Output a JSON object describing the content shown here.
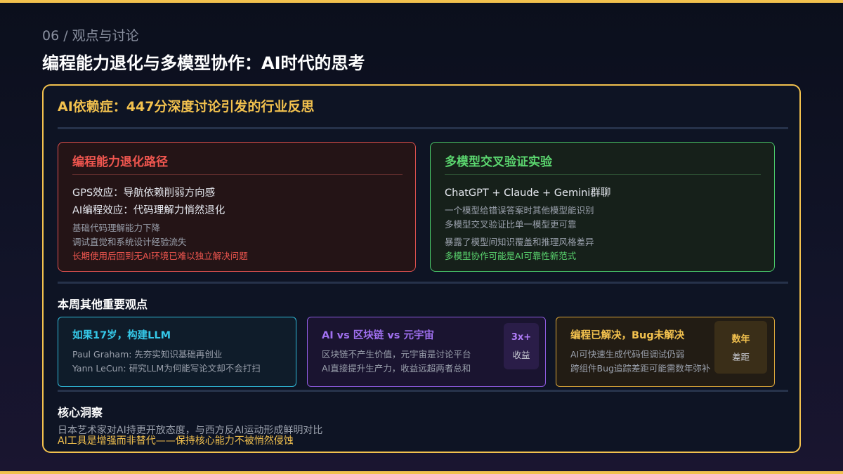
{
  "header": {
    "section_label": "06 / 观点与讨论",
    "title": "编程能力退化与多模型协作：AI时代的思考"
  },
  "panel": {
    "title": "AI依赖症：447分深度讨论引发的行业反思",
    "degradation": {
      "title": "编程能力退化路径",
      "main_lines": [
        "GPS效应：导航依赖削弱方向感",
        "AI编程效应：代码理解力悄然退化"
      ],
      "sub_lines": [
        "基础代码理解能力下降",
        "调试直觉和系统设计经验流失"
      ],
      "highlight": "长期使用后回到无AI环境已难以独立解决问题"
    },
    "multimodel": {
      "title": "多模型交叉验证实验",
      "main_line": "ChatGPT + Claude + Gemini群聊",
      "sub_lines": [
        "一个模型给错误答案时其他模型能识别",
        "多模型交叉验证比单一模型更可靠",
        "暴露了模型间知识覆盖和推理风格差异"
      ],
      "highlight": "多模型协作可能是AI可靠性新范式"
    },
    "weekly": {
      "heading": "本周其他重要观点",
      "cards": [
        {
          "title": "如果17岁，构建LLM",
          "lines": [
            "Paul Graham: 先夯实知识基础再创业",
            "Yann LeCun: 研究LLM为何能写论文却不会打扫"
          ]
        },
        {
          "title": "AI vs 区块链 vs 元宇宙",
          "lines": [
            "区块链不产生价值，元宇宙是讨论平台",
            "AI直接提升生产力，收益远超两者总和"
          ],
          "badge": {
            "value": "3x+",
            "label": "收益"
          }
        },
        {
          "title": "编程已解决，Bug未解决",
          "lines": [
            "AI可快速生成代码但调试仍弱",
            "跨组件Bug追踪差距可能需数年弥补"
          ],
          "badge": {
            "value": "数年",
            "label": "差距"
          }
        }
      ]
    },
    "insight": {
      "heading": "核心洞察",
      "line1": "日本艺术家对AI持更开放态度，与西方反AI运动形成鲜明对比",
      "line2": "AI工具是增强而非替代——保持核心能力不被悄然侵蚀"
    }
  },
  "colors": {
    "accent": "#f2c14e",
    "red": "#f0564f",
    "green": "#5bd66f",
    "cyan": "#35c8e8",
    "purple": "#a070f0",
    "background": "#0e1424"
  }
}
